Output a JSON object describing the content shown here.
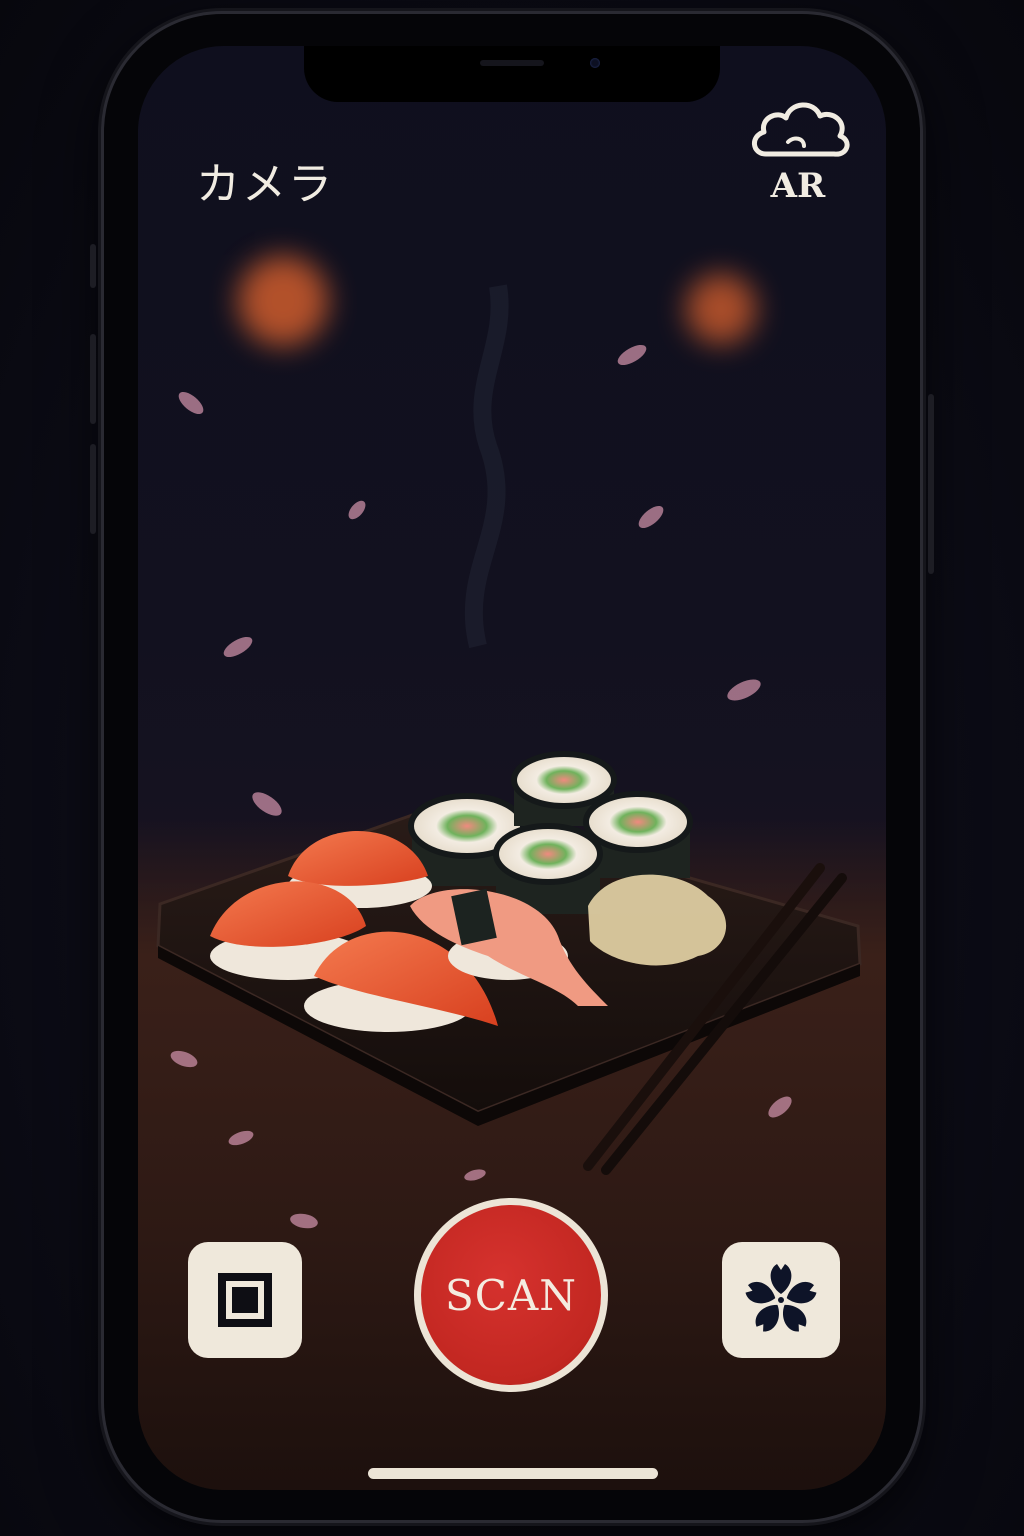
{
  "header": {
    "title": "カメラ",
    "ar_label": "AR",
    "ar_icon": "cloud-icon"
  },
  "scene": {
    "subject": "sushi-plate-photo"
  },
  "controls": {
    "gallery_icon": "square-frame-icon",
    "scan_label": "SCAN",
    "filter_icon": "sakura-flower-icon"
  },
  "colors": {
    "accent_red": "#c22721",
    "cream": "#efe8db",
    "background": "#0f0f1e"
  }
}
